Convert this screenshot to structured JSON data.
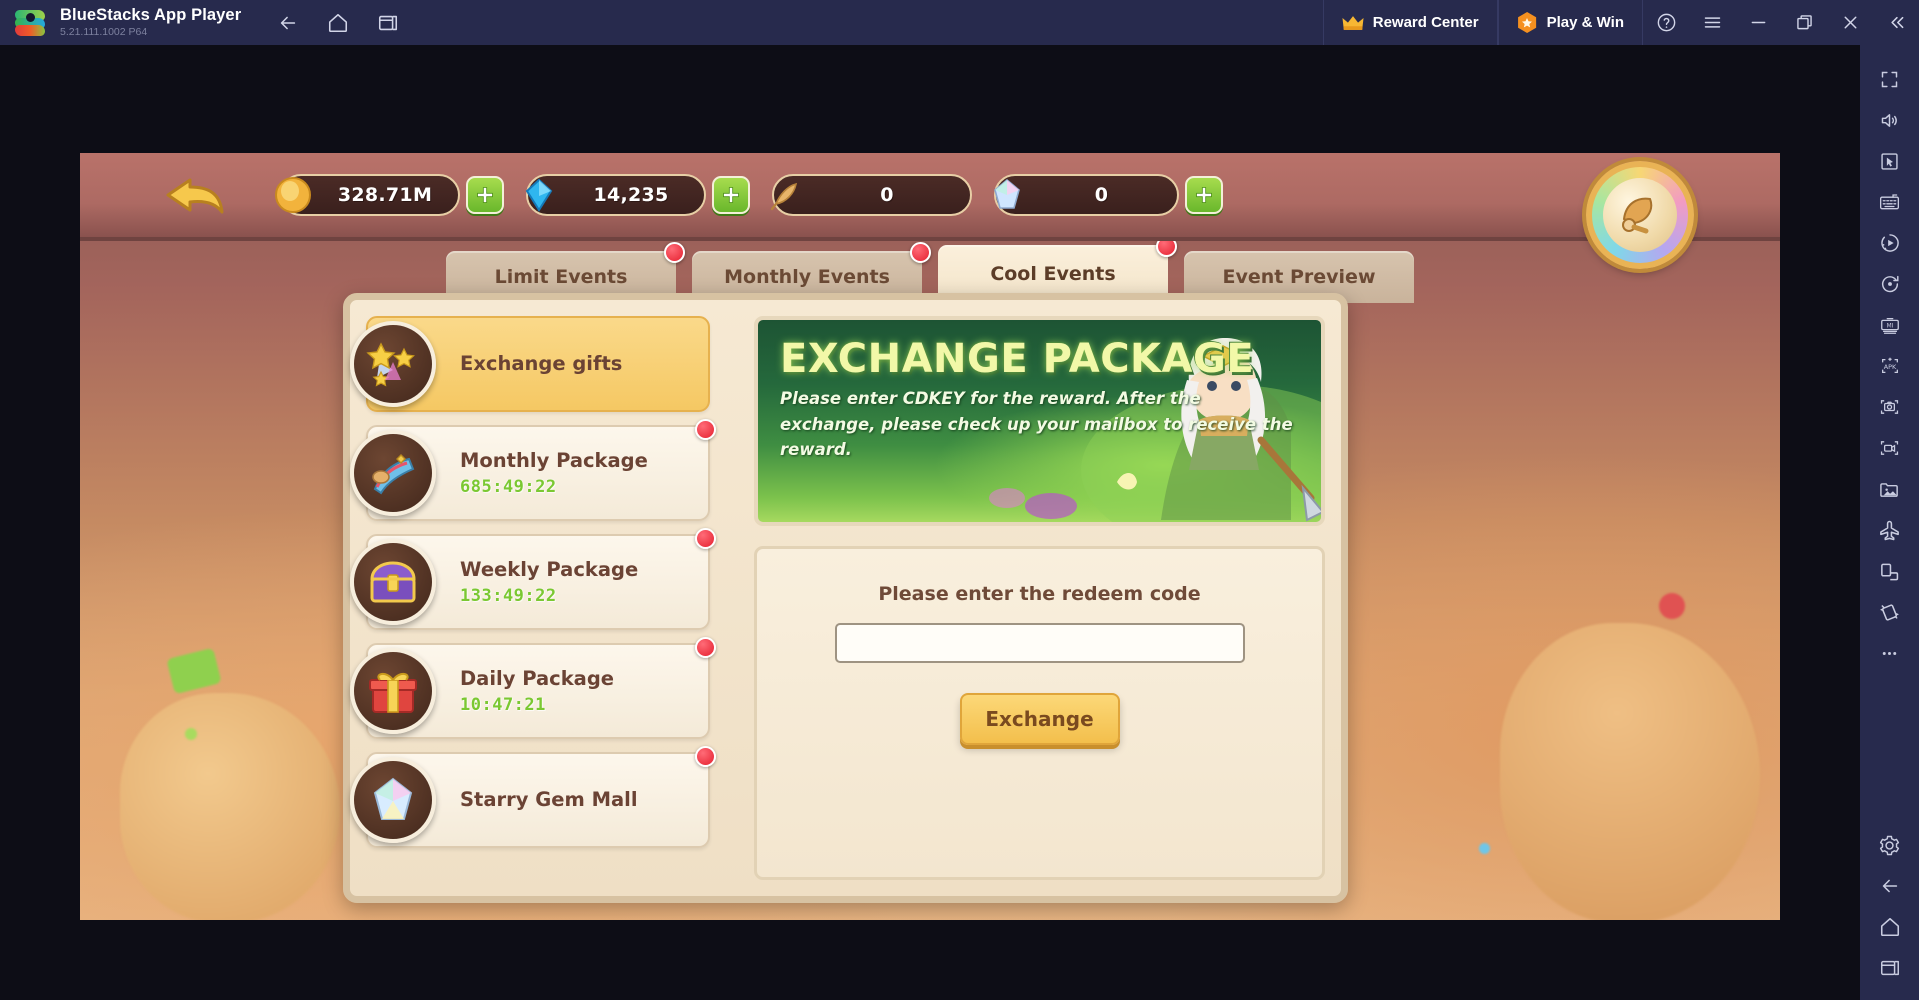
{
  "titlebar": {
    "app_name": "BlueStacks App Player",
    "version": "5.21.111.1002  P64",
    "logo_icon": "bluestacks-logo",
    "nav": [
      {
        "name": "back",
        "icon": "arrow-left-icon"
      },
      {
        "name": "home",
        "icon": "home-icon"
      },
      {
        "name": "recents",
        "icon": "multi-window-icon"
      }
    ],
    "reward_center": {
      "label": "Reward Center",
      "icon": "crown-icon"
    },
    "play_and_win": {
      "label": "Play & Win",
      "icon": "hex-star-icon"
    },
    "window_controls": [
      {
        "name": "help",
        "icon": "question-circle-icon"
      },
      {
        "name": "menu",
        "icon": "hamburger-icon"
      },
      {
        "name": "minimize",
        "icon": "minimize-icon"
      },
      {
        "name": "maximize",
        "icon": "maximize-icon"
      },
      {
        "name": "close",
        "icon": "close-icon"
      },
      {
        "name": "collapse-sidebar",
        "icon": "double-chevron-left-icon"
      }
    ]
  },
  "sidebar": {
    "items": [
      {
        "name": "fullscreen",
        "icon": "fullscreen-icon"
      },
      {
        "name": "volume",
        "icon": "speaker-icon"
      },
      {
        "name": "game-controls",
        "icon": "cursor-box-icon"
      },
      {
        "name": "keyboard-controls",
        "icon": "keyboard-icon"
      },
      {
        "name": "macro-recorder",
        "icon": "play-dial-icon"
      },
      {
        "name": "sync-operations",
        "icon": "rotate-dot-icon"
      },
      {
        "name": "multi-instance",
        "icon": "mi-instance-icon"
      },
      {
        "name": "install-apk",
        "icon": "apk-icon"
      },
      {
        "name": "screenshot",
        "icon": "camera-icon"
      },
      {
        "name": "record-screen",
        "icon": "video-camera-icon"
      },
      {
        "name": "media-manager",
        "icon": "image-folder-icon"
      },
      {
        "name": "flight-mode",
        "icon": "airplane-icon"
      },
      {
        "name": "rotate-device",
        "icon": "device-rotate-icon"
      },
      {
        "name": "shake-device",
        "icon": "shake-icon"
      },
      {
        "name": "more-options",
        "icon": "ellipsis-icon"
      },
      {
        "name": "settings",
        "icon": "gear-icon"
      },
      {
        "name": "android-back",
        "icon": "arrow-left-icon"
      },
      {
        "name": "android-home",
        "icon": "home-icon"
      },
      {
        "name": "android-recents",
        "icon": "multi-window-icon"
      }
    ]
  },
  "game": {
    "back_button_icon": "curved-back-arrow-icon",
    "currencies": [
      {
        "name": "gold",
        "icon": "gold-coin-icon",
        "value": "328.71M",
        "has_plus": true
      },
      {
        "name": "gems",
        "icon": "blue-gem-icon",
        "value": "14,235",
        "has_plus": true
      },
      {
        "name": "wheat",
        "icon": "wheat-icon",
        "value": "0",
        "has_plus": false
      },
      {
        "name": "starry-gem",
        "icon": "starry-gem-icon",
        "value": "0",
        "has_plus": true
      }
    ],
    "medallion_icon": "golden-trophy-medallion",
    "tabs": [
      {
        "label": "Limit Events",
        "active": false,
        "badge": true
      },
      {
        "label": "Monthly Events",
        "active": false,
        "badge": true
      },
      {
        "label": "Cool Events",
        "active": true,
        "badge": true
      },
      {
        "label": "Event Preview",
        "active": false,
        "badge": false
      }
    ],
    "packages": [
      {
        "label": "Exchange gifts",
        "timer": "",
        "icon": "stars-gift-icon",
        "selected": true,
        "badge": false
      },
      {
        "label": "Monthly Package",
        "timer": "685:49:22",
        "icon": "monthly-gift-icon",
        "selected": false,
        "badge": true
      },
      {
        "label": "Weekly Package",
        "timer": "133:49:22",
        "icon": "treasure-chest-icon",
        "selected": false,
        "badge": true
      },
      {
        "label": "Daily Package",
        "timer": "10:47:21",
        "icon": "gift-box-icon",
        "selected": false,
        "badge": true
      },
      {
        "label": "Starry Gem Mall",
        "timer": "",
        "icon": "starry-gem-icon",
        "selected": false,
        "badge": true
      }
    ],
    "banner": {
      "title": "EXCHANGE PACKAGE",
      "description": "Please enter CDKEY for the reward. After the exchange, please check up your mailbox to receive the reward."
    },
    "redeem": {
      "label": "Please enter the redeem code",
      "input_value": "",
      "input_placeholder": "",
      "button_label": "Exchange"
    }
  },
  "colors": {
    "titlebar_bg": "#272a4d",
    "accent_orange": "#f5901f",
    "badge_red": "#e5202f",
    "timer_green": "#7bc832",
    "panel_cream": "#f6e9d3",
    "selected_gold": "#f5c863"
  }
}
